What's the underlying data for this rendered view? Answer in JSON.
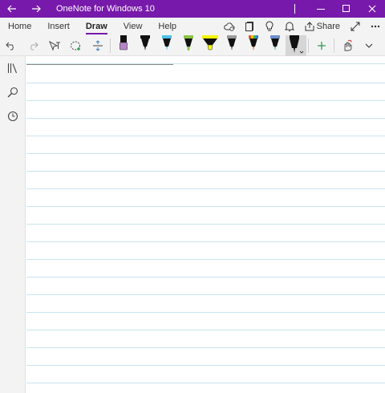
{
  "window": {
    "title": "OneNote for Windows 10",
    "back_icon": "arrow-left-icon",
    "forward_icon": "arrow-right-icon",
    "accent": "#7719aa"
  },
  "ribbon": {
    "tabs": [
      {
        "label": "Home",
        "active": false
      },
      {
        "label": "Insert",
        "active": false
      },
      {
        "label": "Draw",
        "active": true
      },
      {
        "label": "View",
        "active": false
      },
      {
        "label": "Help",
        "active": false
      }
    ],
    "share_label": "Share"
  },
  "pens": [
    {
      "name": "purple-pen-icon",
      "color": "#b784c9"
    },
    {
      "name": "black-pen-icon",
      "color": "#111111"
    },
    {
      "name": "light-blue-pen-icon",
      "color": "#4cc2e8"
    },
    {
      "name": "green-highlighter-icon",
      "color": "#8bc34a"
    },
    {
      "name": "yellow-highlighter-icon",
      "color": "#f5f500"
    },
    {
      "name": "galaxy-pen-icon",
      "color": "#9a9a9a"
    },
    {
      "name": "rainbow-pen-icon",
      "color": "#e25a2a"
    },
    {
      "name": "ocean-pen-icon",
      "color": "#6a8fd0"
    },
    {
      "name": "black-pen-selected-icon",
      "color": "#111111"
    }
  ]
}
